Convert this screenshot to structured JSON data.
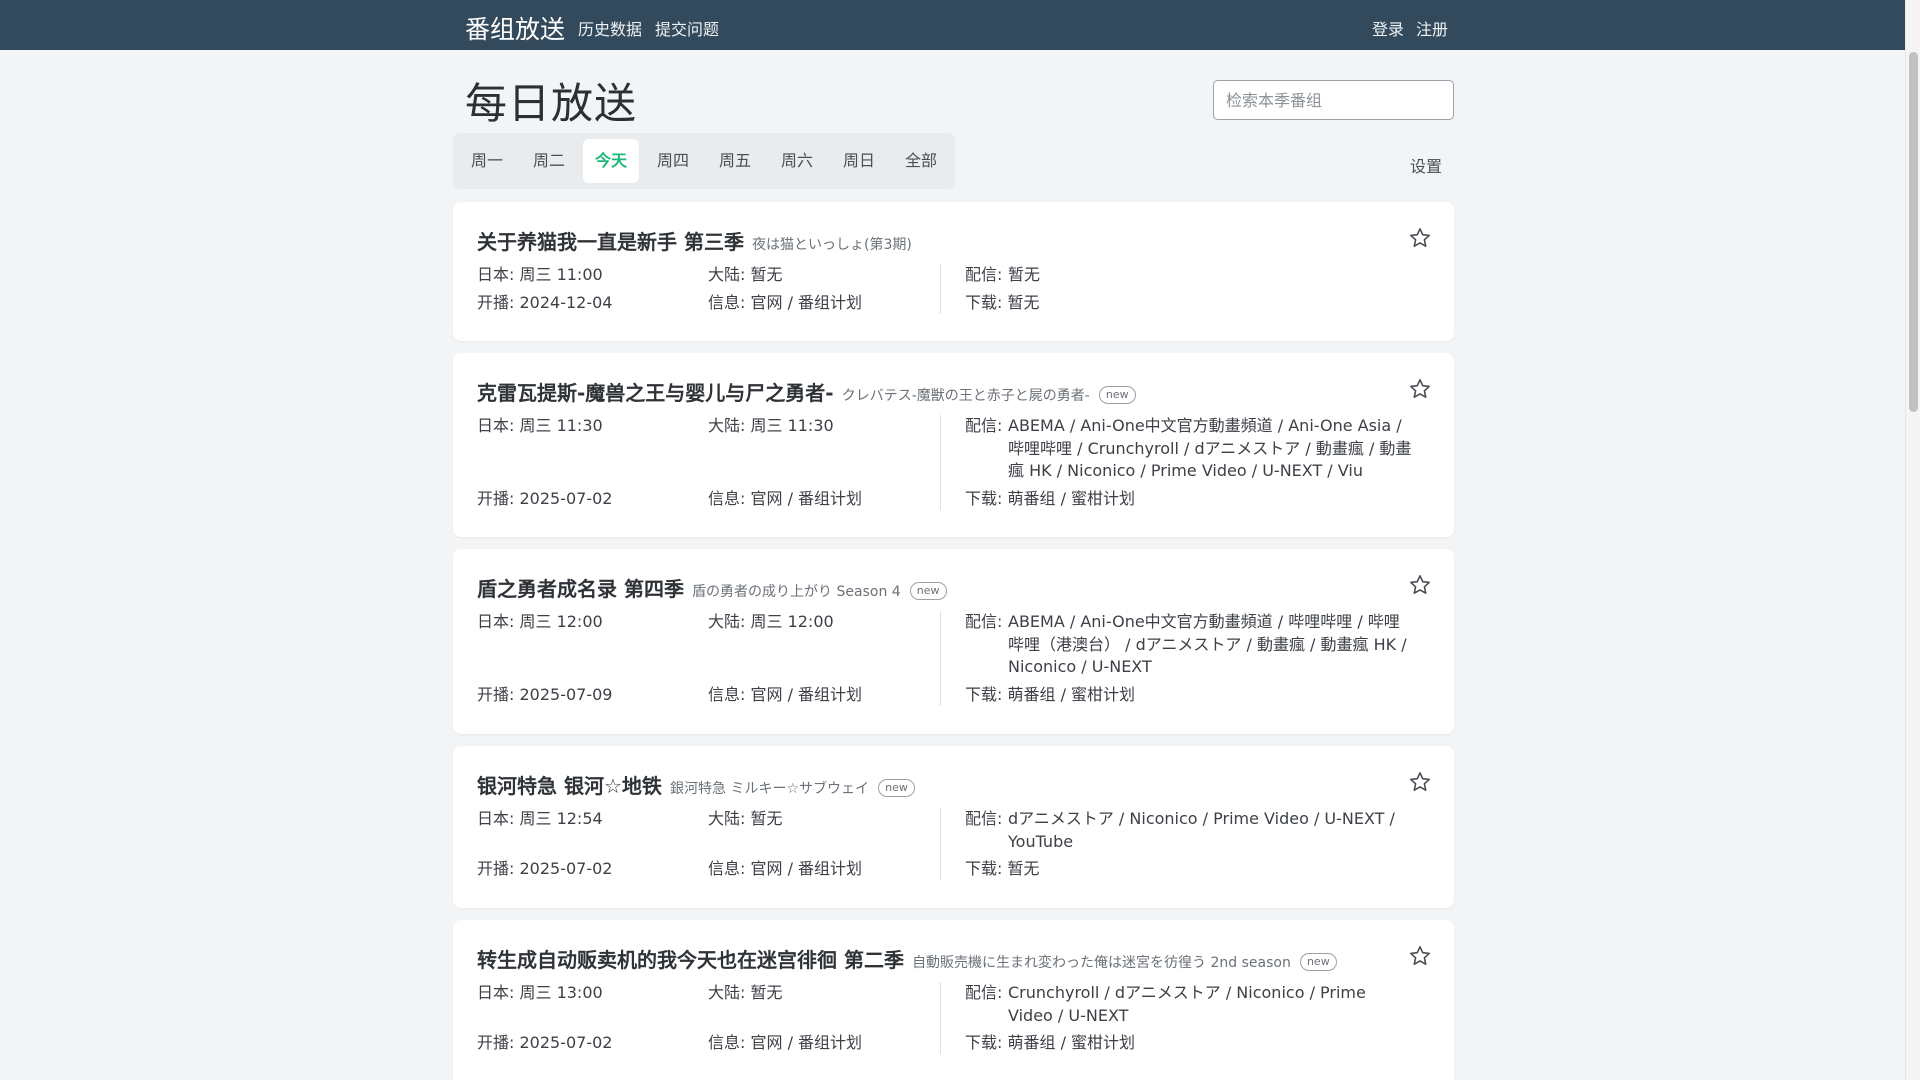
{
  "nav": {
    "brand": "番组放送",
    "links": [
      "历史数据",
      "提交问题"
    ],
    "login": "登录",
    "register": "注册"
  },
  "page": {
    "title": "每日放送",
    "search_placeholder": "检索本季番组",
    "days": [
      "周一",
      "周二",
      "今天",
      "周四",
      "周五",
      "周六",
      "周日",
      "全部"
    ],
    "active_day": "今天",
    "settings": "设置"
  },
  "labels": {
    "japan": "日本: ",
    "mainland": "大陆: ",
    "premiere": "开播: ",
    "info": "信息: ",
    "streaming": "配信:",
    "download": "下载: "
  },
  "accent_color": "#20b77a",
  "shows": [
    {
      "title": "关于养猫我一直是新手 第三季",
      "jp_title": "夜は猫といっしょ(第3期)",
      "new": "",
      "japan": "周三 11:00",
      "mainland": "暂无",
      "premiere": "2024-12-04",
      "info": "官网 / 番组计划",
      "streaming": "暂无",
      "download": "暂无"
    },
    {
      "title": "克雷瓦提斯-魔兽之王与婴儿与尸之勇者-",
      "jp_title": "クレバテス-魔獣の王と赤子と屍の勇者-",
      "new": "new",
      "japan": "周三 11:30",
      "mainland": "周三 11:30",
      "premiere": "2025-07-02",
      "info": "官网 / 番组计划",
      "streaming": "ABEMA / Ani-One中文官方動畫頻道 / Ani-One Asia / 哔哩哔哩 / Crunchyroll / dアニメストア / 動畫瘋 / 動畫瘋 HK / Niconico / Prime Video / U-NEXT / Viu",
      "download": "萌番组 / 蜜柑计划"
    },
    {
      "title": "盾之勇者成名录 第四季",
      "jp_title": "盾の勇者の成り上がり Season 4",
      "new": "new",
      "japan": "周三 12:00",
      "mainland": "周三 12:00",
      "premiere": "2025-07-09",
      "info": "官网 / 番组计划",
      "streaming": "ABEMA / Ani-One中文官方動畫頻道 / 哔哩哔哩 / 哔哩哔哩（港澳台） / dアニメストア / 動畫瘋 / 動畫瘋 HK / Niconico / U-NEXT",
      "download": "萌番组 / 蜜柑计划"
    },
    {
      "title": "银河特急 银河☆地铁",
      "jp_title": "銀河特急 ミルキー☆サブウェイ",
      "new": "new",
      "japan": "周三 12:54",
      "mainland": "暂无",
      "premiere": "2025-07-02",
      "info": "官网 / 番组计划",
      "streaming": "dアニメストア / Niconico / Prime Video / U-NEXT / YouTube",
      "download": "暂无"
    },
    {
      "title": "转生成自动贩卖机的我今天也在迷宫徘徊 第二季",
      "jp_title": "自動販売機に生まれ変わった俺は迷宮を彷徨う 2nd season",
      "new": "new",
      "japan": "周三 13:00",
      "mainland": "暂无",
      "premiere": "2025-07-02",
      "info": "官网 / 番组计划",
      "streaming": "Crunchyroll / dアニメストア / Niconico / Prime Video / U-NEXT",
      "download": "萌番组 / 蜜柑计划"
    }
  ]
}
